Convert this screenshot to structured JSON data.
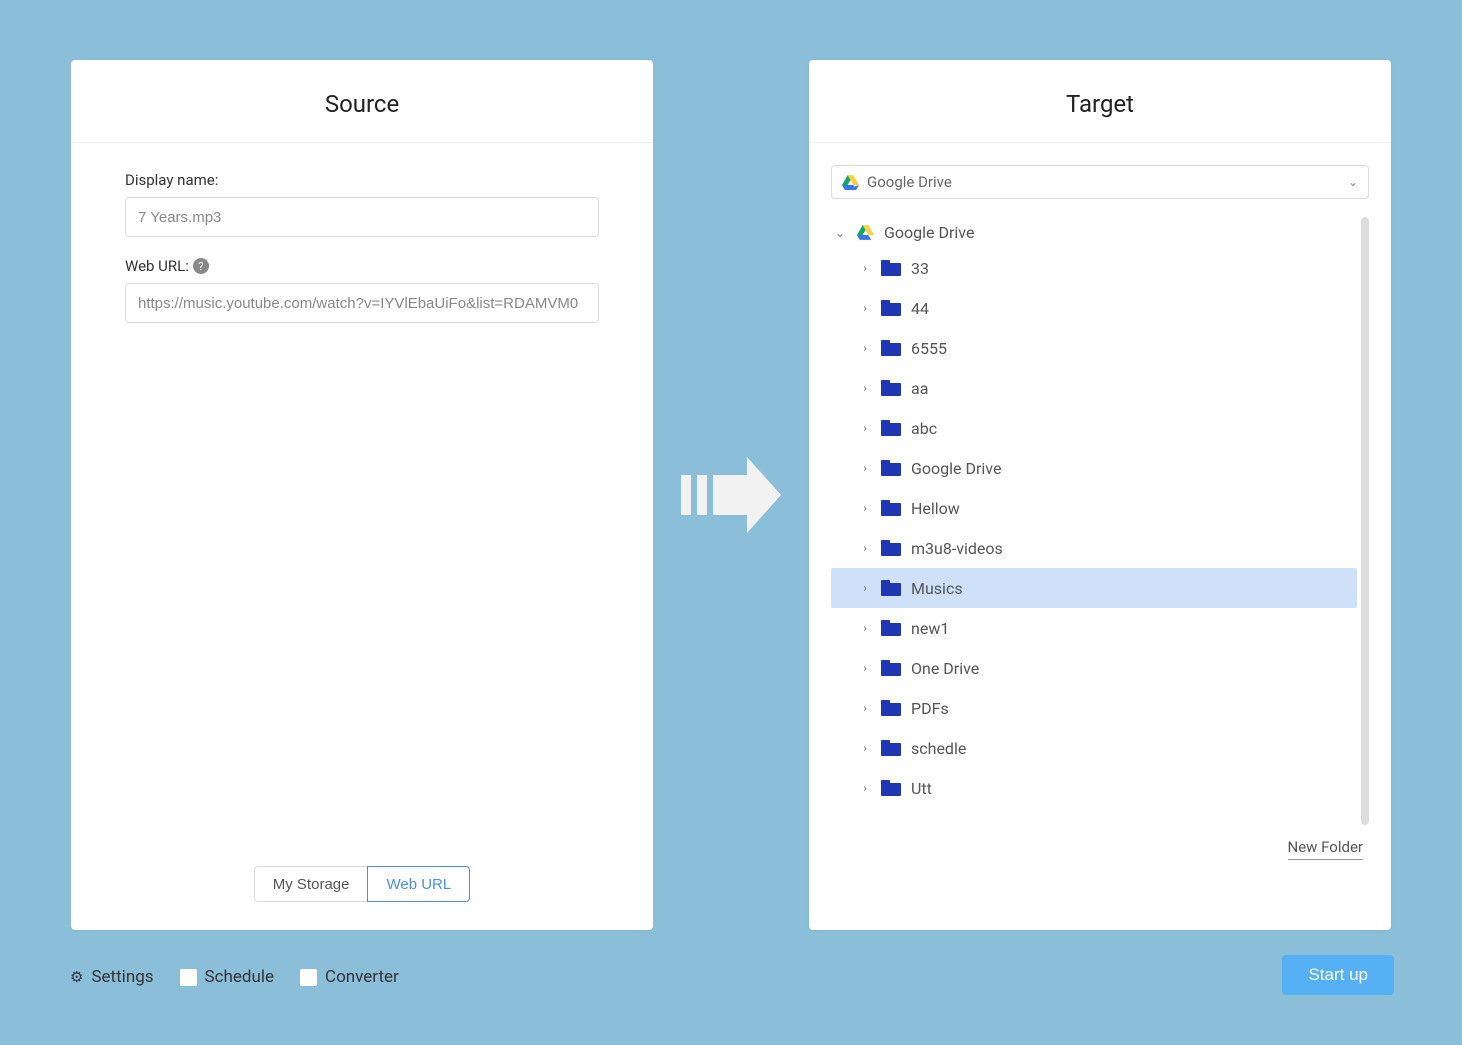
{
  "source": {
    "title": "Source",
    "display_name_label": "Display name:",
    "display_name_value": "7 Years.mp3",
    "web_url_label": "Web URL:",
    "web_url_value": "https://music.youtube.com/watch?v=IYVlEbaUiFo&list=RDAMVM0",
    "tabs": {
      "my_storage": "My Storage",
      "web_url": "Web URL",
      "active": "web_url"
    }
  },
  "target": {
    "title": "Target",
    "selector_label": "Google Drive",
    "root_label": "Google Drive",
    "folders": [
      {
        "name": "33",
        "selected": false
      },
      {
        "name": "44",
        "selected": false
      },
      {
        "name": "6555",
        "selected": false
      },
      {
        "name": "aa",
        "selected": false
      },
      {
        "name": "abc",
        "selected": false
      },
      {
        "name": "Google Drive",
        "selected": false
      },
      {
        "name": "Hellow",
        "selected": false
      },
      {
        "name": "m3u8-videos",
        "selected": false
      },
      {
        "name": "Musics",
        "selected": true
      },
      {
        "name": "new1",
        "selected": false
      },
      {
        "name": "One Drive",
        "selected": false
      },
      {
        "name": "PDFs",
        "selected": false
      },
      {
        "name": "schedle",
        "selected": false
      },
      {
        "name": "Utt",
        "selected": false
      }
    ],
    "new_folder_label": "New Folder"
  },
  "footer": {
    "settings": "Settings",
    "schedule": "Schedule",
    "converter": "Converter",
    "start": "Start up"
  }
}
